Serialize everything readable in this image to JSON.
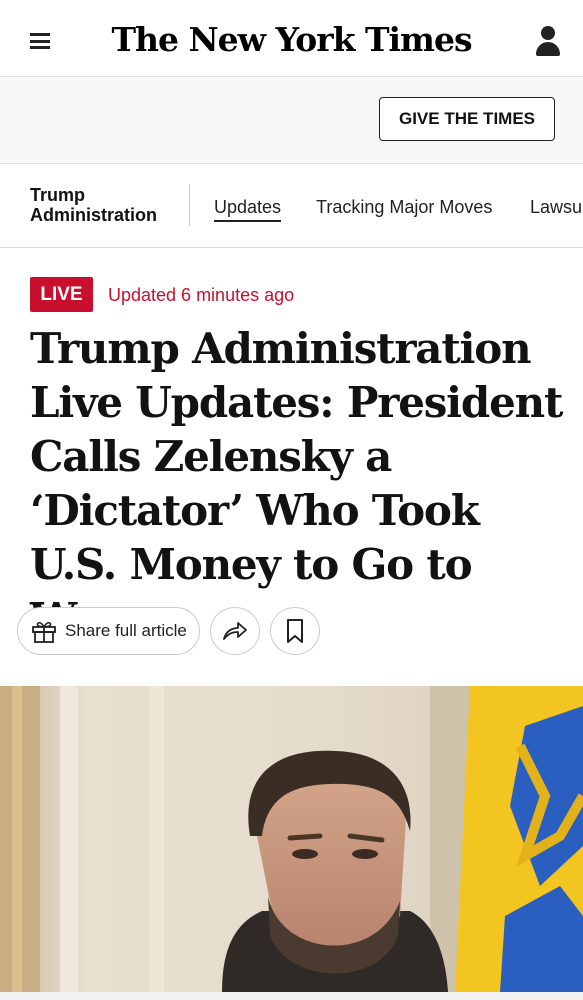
{
  "header": {
    "logo": "The New York Times",
    "menu_icon": "hamburger-menu-icon",
    "account_icon": "account-icon"
  },
  "promo": {
    "button_label": "GIVE THE TIMES"
  },
  "subnav": {
    "section_title_line1": "Trump",
    "section_title_line2": "Administration",
    "tabs": [
      {
        "label": "Updates",
        "active": true
      },
      {
        "label": "Tracking Major Moves",
        "active": false
      },
      {
        "label": "Lawsuits",
        "active": false
      }
    ]
  },
  "article": {
    "live_badge": "LIVE",
    "updated": "Updated 6 minutes ago",
    "headline": "Trump Administration Live Updates: President Calls Zelensky a ‘Dictator’ Who Took U.S. Money to Go to War",
    "share_label": "Share full article",
    "share_icon": "gift-icon",
    "forward_icon": "share-arrow-icon",
    "save_icon": "bookmark-icon"
  },
  "colors": {
    "live_red": "#c8102e",
    "text": "#121212",
    "border": "#dcdcdc"
  }
}
